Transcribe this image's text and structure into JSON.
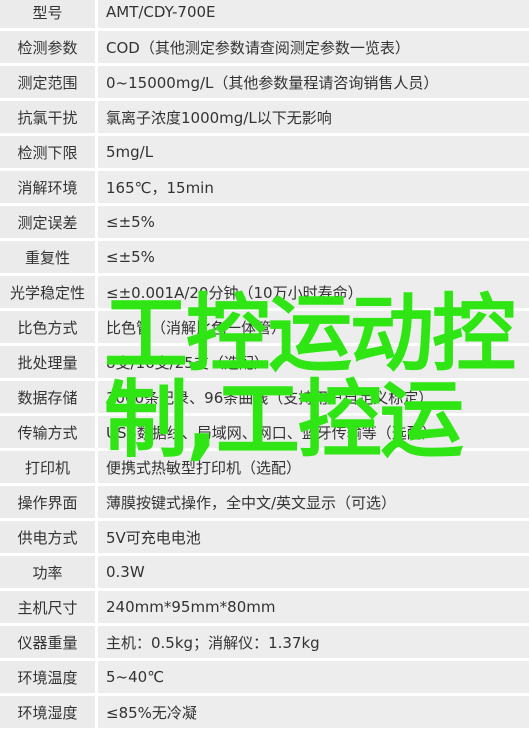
{
  "specs": [
    {
      "label": "型号",
      "value": "AMT/CDY-700E"
    },
    {
      "label": "检测参数",
      "value": "COD（其他测定参数请查阅测定参数一览表）"
    },
    {
      "label": "测定范围",
      "value": "0~15000mg/L（其他参数量程请咨询销售人员）"
    },
    {
      "label": "抗氯干扰",
      "value": "氯离子浓度1000mg/L以下无影响"
    },
    {
      "label": "检测下限",
      "value": "5mg/L"
    },
    {
      "label": "消解环境",
      "value": "165℃，15min"
    },
    {
      "label": "测定误差",
      "value": "≤±5%"
    },
    {
      "label": "重复性",
      "value": "≤±5%"
    },
    {
      "label": "光学稳定性",
      "value": "≤±0.001A/20分钟（10万小时寿命）"
    },
    {
      "label": "比色方式",
      "value": "比色管（消解比色一体管）"
    },
    {
      "label": "批处理量",
      "value": "8支/16支/25支（选配）"
    },
    {
      "label": "数据存储",
      "value": "3000条记录、96条曲线（支持用户自定义标定）"
    },
    {
      "label": "传输方式",
      "value": "USB数据线、局域网、网口、蓝牙传输等（选配）"
    },
    {
      "label": "打印机",
      "value": "便携式热敏型打印机（选配）"
    },
    {
      "label": "操作界面",
      "value": "薄膜按键式操作，全中文/英文显示（可选）"
    },
    {
      "label": "供电方式",
      "value": "5V可充电电池"
    },
    {
      "label": "功率",
      "value": "0.3W"
    },
    {
      "label": "主机尺寸",
      "value": "240mm*95mm*80mm"
    },
    {
      "label": "仪器重量",
      "value": "主机：0.5kg；消解仪：1.37kg"
    },
    {
      "label": "环境温度",
      "value": "5~40℃"
    },
    {
      "label": "环境湿度",
      "value": "≤85%无冷凝"
    }
  ],
  "watermark": {
    "line1": "工控运动控",
    "line2": "制,工控运",
    "color": "#2fe614"
  }
}
